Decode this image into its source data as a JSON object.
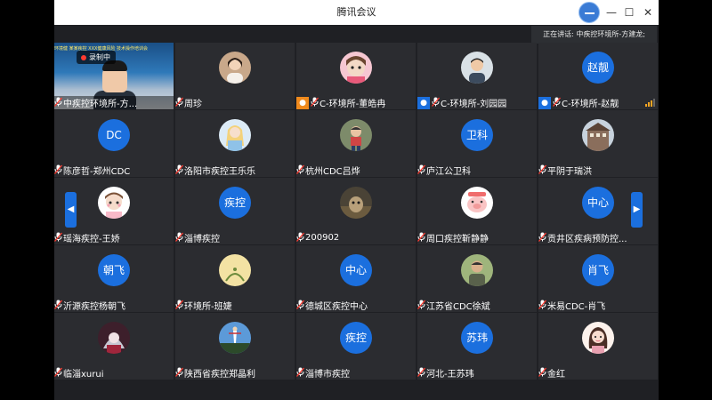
{
  "window": {
    "title": "腾讯会议",
    "speaking": "正在讲话: 中疾控环境所-方建龙;"
  },
  "controls": {
    "minimize": "—",
    "maximize": "☐",
    "close": "✕"
  },
  "recording": {
    "label": "录制中"
  },
  "video": {
    "banner": "环境健 某某疾控 XXX健康风险 技术操作培训会"
  },
  "nav": {
    "left": "◀",
    "right": "▶"
  },
  "colors": {
    "avatar_blue": "#1b6fde",
    "host_orange": "#f08a1c",
    "tile_bg": "#2b2c30"
  },
  "tiles": [
    {
      "name": "中疾控环境所-方...",
      "avatar": "video"
    },
    {
      "name": "周珍",
      "avatar": "photo-girl"
    },
    {
      "name": "C-环境所-董皓冉",
      "avatar": "photo-cartoon-girl",
      "badge": "host"
    },
    {
      "name": "C-环境所-刘园园",
      "avatar": "photo-boy",
      "badge": "cohost"
    },
    {
      "name": "C-环境所-赵靓",
      "avatar_text": "赵靓",
      "badge": "cohost",
      "signal": true
    },
    {
      "name": "陈彦哲-郑州CDC",
      "avatar_text": "DC"
    },
    {
      "name": "洛阳市疾控王乐乐",
      "avatar": "photo-princess"
    },
    {
      "name": "杭州CDC吕烨",
      "avatar": "photo-child"
    },
    {
      "name": "庐江公卫科",
      "avatar_text": "卫科"
    },
    {
      "name": "平阴于瑞洪",
      "avatar": "photo-building"
    },
    {
      "name": "瑶海疾控-王娇",
      "avatar": "photo-baby"
    },
    {
      "name": "淄博疾控",
      "avatar_text": "疾控"
    },
    {
      "name": "200902",
      "avatar": "photo-dark"
    },
    {
      "name": "周口疾控靳静静",
      "avatar": "photo-pig"
    },
    {
      "name": "贡井区疾病预防控...",
      "avatar_text": "中心"
    },
    {
      "name": "沂源疾控杨朝飞",
      "avatar_text": "朝飞"
    },
    {
      "name": "环境所-班婕",
      "avatar": "photo-yellow"
    },
    {
      "name": "德城区疾控中心",
      "avatar_text": "中心"
    },
    {
      "name": "江苏省CDC徐斌",
      "avatar": "photo-man"
    },
    {
      "name": "米易CDC-肖飞",
      "avatar_text": "肖飞"
    },
    {
      "name": "临淄xurui",
      "avatar": "photo-anime"
    },
    {
      "name": "陕西省疾控郑晶利",
      "avatar": "photo-sky"
    },
    {
      "name": "淄博市疾控",
      "avatar_text": "疾控"
    },
    {
      "name": "河北-王苏玮",
      "avatar_text": "苏玮"
    },
    {
      "name": "金红",
      "avatar": "photo-woman"
    }
  ]
}
